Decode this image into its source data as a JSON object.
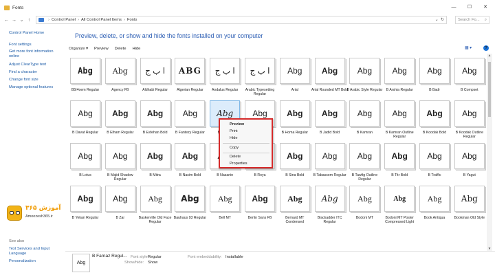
{
  "window": {
    "title": "Fonts",
    "minimize": "—",
    "maximize": "☐",
    "close": "✕"
  },
  "nav": {
    "back": "←",
    "forward": "→",
    "recent": "⌄",
    "up": "↑"
  },
  "address": {
    "crumbs": [
      "Control Panel",
      "All Control Panel Items",
      "Fonts"
    ],
    "dropdown": "⌄",
    "refresh": "↻"
  },
  "search": {
    "placeholder": "Search Fo...",
    "icon": "⌕"
  },
  "sidebar": {
    "items": [
      "Control Panel Home",
      "Font settings",
      "Get more font information online",
      "Adjust ClearType text",
      "Find a character",
      "Change font size",
      "Manage optional features"
    ],
    "see_also": "See also",
    "see_also_items": [
      "Text Services and Input Language",
      "Personalization"
    ]
  },
  "watermark": {
    "brand": "آموزش ۳۶۵",
    "url": "Amoozesh365.ir"
  },
  "main": {
    "heading": "Preview, delete, or show and hide the fonts installed on your computer"
  },
  "toolbar": {
    "organize": "Organize ▾",
    "preview": "Preview",
    "delete": "Delete",
    "hide": "Hide",
    "view_icon": "▦ ▾",
    "help": "?"
  },
  "fonts": [
    {
      "sample": "Abg",
      "name": "B5I4oem Regular"
    },
    {
      "sample": "Abg",
      "name": "Agency FB"
    },
    {
      "sample": "ا ب ج",
      "name": "Aldhabi Regular"
    },
    {
      "sample": "ABG",
      "name": "Algerian Regular"
    },
    {
      "sample": "ا ب ج",
      "name": "Andalus Regular"
    },
    {
      "sample": "ا ب ج",
      "name": "Arabic Typesetting Regular"
    },
    {
      "sample": "Abg",
      "name": "Arial"
    },
    {
      "sample": "Abg",
      "name": "Arial Rounded MT Bold"
    },
    {
      "sample": "Abg",
      "name": "B Arabic Style Regular"
    },
    {
      "sample": "Abg",
      "name": "B Arshia Regular"
    },
    {
      "sample": "Abg",
      "name": "B Badr"
    },
    {
      "sample": "Abg",
      "name": "B Compset"
    },
    {
      "sample": "Abg",
      "name": "B Davat Regular"
    },
    {
      "sample": "Abg",
      "name": "B Elham Regular"
    },
    {
      "sample": "Abg",
      "name": "B Esfehan Bold"
    },
    {
      "sample": "Abg",
      "name": "B Fantezy Regular"
    },
    {
      "sample": "Abg",
      "name": "B Farnaz"
    },
    {
      "sample": "Abg",
      "name": ""
    },
    {
      "sample": "Abg",
      "name": "B Homa Regular"
    },
    {
      "sample": "Abg",
      "name": "B Jadid Bold"
    },
    {
      "sample": "Abg",
      "name": "B Kamran"
    },
    {
      "sample": "Abg",
      "name": "B Kamran Outline Regular"
    },
    {
      "sample": "Abg",
      "name": "B Koodak Bold"
    },
    {
      "sample": "Abg",
      "name": "B Koodak Outline Regular"
    },
    {
      "sample": "Abg",
      "name": "B Lotus"
    },
    {
      "sample": "Abg",
      "name": "B Majid Shadow Regular"
    },
    {
      "sample": "Abg",
      "name": "B Mitra"
    },
    {
      "sample": "Abg",
      "name": "B Nasim Bold"
    },
    {
      "sample": "Abg",
      "name": "B Nazanin"
    },
    {
      "sample": "Abg",
      "name": "B Roya"
    },
    {
      "sample": "Abg",
      "name": "B Sina Bold"
    },
    {
      "sample": "Abg",
      "name": "B Tabassom Regular"
    },
    {
      "sample": "Abg",
      "name": "B Tawfig Outline Regular"
    },
    {
      "sample": "Abg",
      "name": "B Titr Bold"
    },
    {
      "sample": "Abg",
      "name": "B Traffic"
    },
    {
      "sample": "Abg",
      "name": "B Yagut"
    },
    {
      "sample": "Abg",
      "name": "B Yekan Regular"
    },
    {
      "sample": "Abg",
      "name": "B Zar"
    },
    {
      "sample": "Abg",
      "name": "Baskerville Old Face Regular"
    },
    {
      "sample": "Abg",
      "name": "Bauhaus 93 Regular"
    },
    {
      "sample": "Abg",
      "name": "Bell MT"
    },
    {
      "sample": "Abg",
      "name": "Berlin Sans FB"
    },
    {
      "sample": "Abg",
      "name": "Bernard MT Condensed"
    },
    {
      "sample": "Abg",
      "name": "Blackadder ITC Regular"
    },
    {
      "sample": "Abg",
      "name": "Bodoni MT"
    },
    {
      "sample": "Abg",
      "name": "Bodoni MT Poster Compressed Light"
    },
    {
      "sample": "Abg",
      "name": "Book Antiqua"
    },
    {
      "sample": "Abg",
      "name": "Bookman Old Style"
    }
  ],
  "context_menu": {
    "items": [
      "Preview",
      "Print",
      "Hide",
      "Copy",
      "Delete",
      "Properties"
    ]
  },
  "details": {
    "sample": "Abg",
    "name": "B Farnaz Regul...",
    "style_label": "Font style:",
    "style_value": "Regular",
    "showhide_label": "Show/hide:",
    "showhide_value": "Show",
    "embed_label": "Font embeddability:",
    "embed_value": "Installable"
  }
}
